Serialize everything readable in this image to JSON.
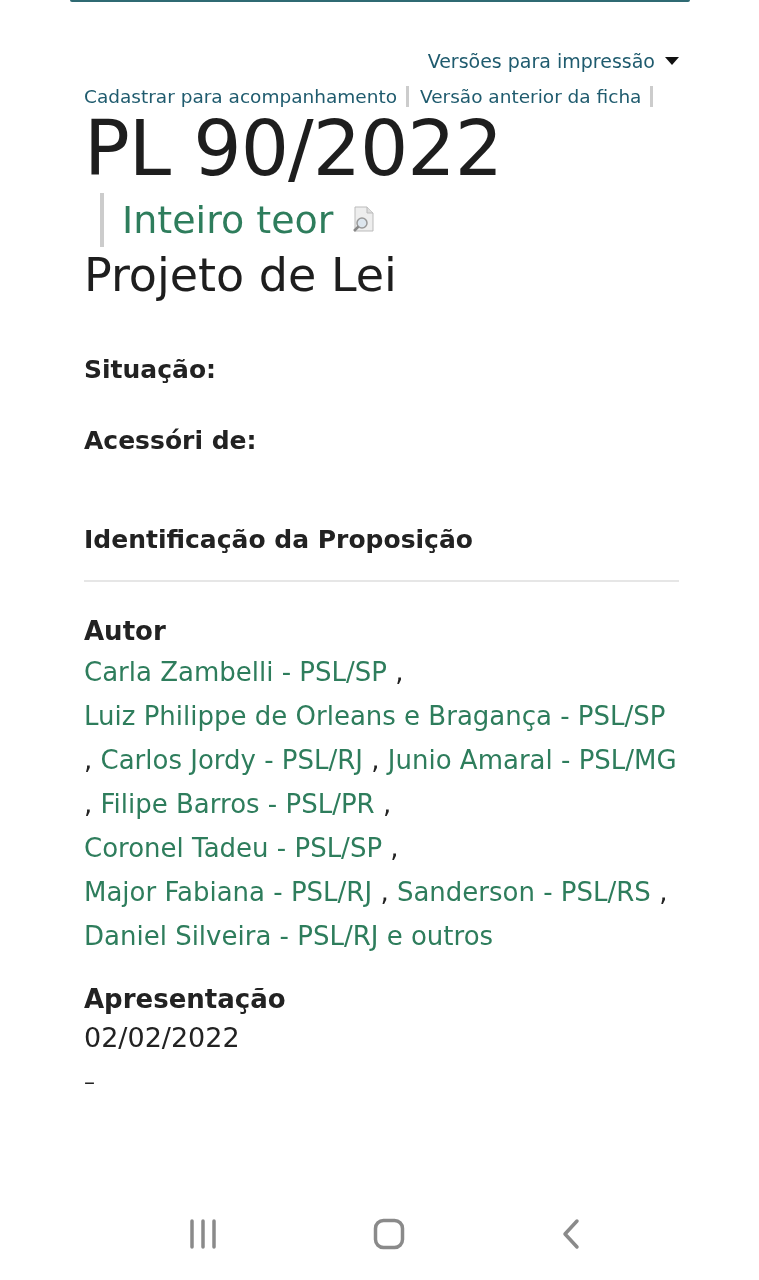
{
  "print_versions": {
    "label": "Versões para impressão"
  },
  "top_links": [
    "Cadastrar para acompanhamento",
    "Versão anterior da ficha"
  ],
  "title": "PL 90/2022",
  "full_text_link": "Inteiro teor",
  "subtitle": "Projeto de Lei",
  "fields": [
    {
      "label": "Situação:"
    },
    {
      "label": "Acessóri de:"
    }
  ],
  "section_title": "Identificação da Proposição",
  "author": {
    "label": "Autor",
    "separator": ",",
    "names": [
      "Carla Zambelli - PSL/SP",
      "Luiz Philippe de Orleans e Bragança - PSL/SP",
      "Carlos Jordy - PSL/RJ",
      "Junio Amaral - PSL/MG",
      "Filipe Barros - PSL/PR",
      "Coronel Tadeu - PSL/SP",
      "Major Fabiana - PSL/RJ",
      "Sanderson - PSL/RS",
      "Daniel Silveira - PSL/RJ"
    ],
    "others": "e outros"
  },
  "presentation": {
    "label": "Apresentação",
    "value": "02/02/2022"
  },
  "cut_text": "–"
}
